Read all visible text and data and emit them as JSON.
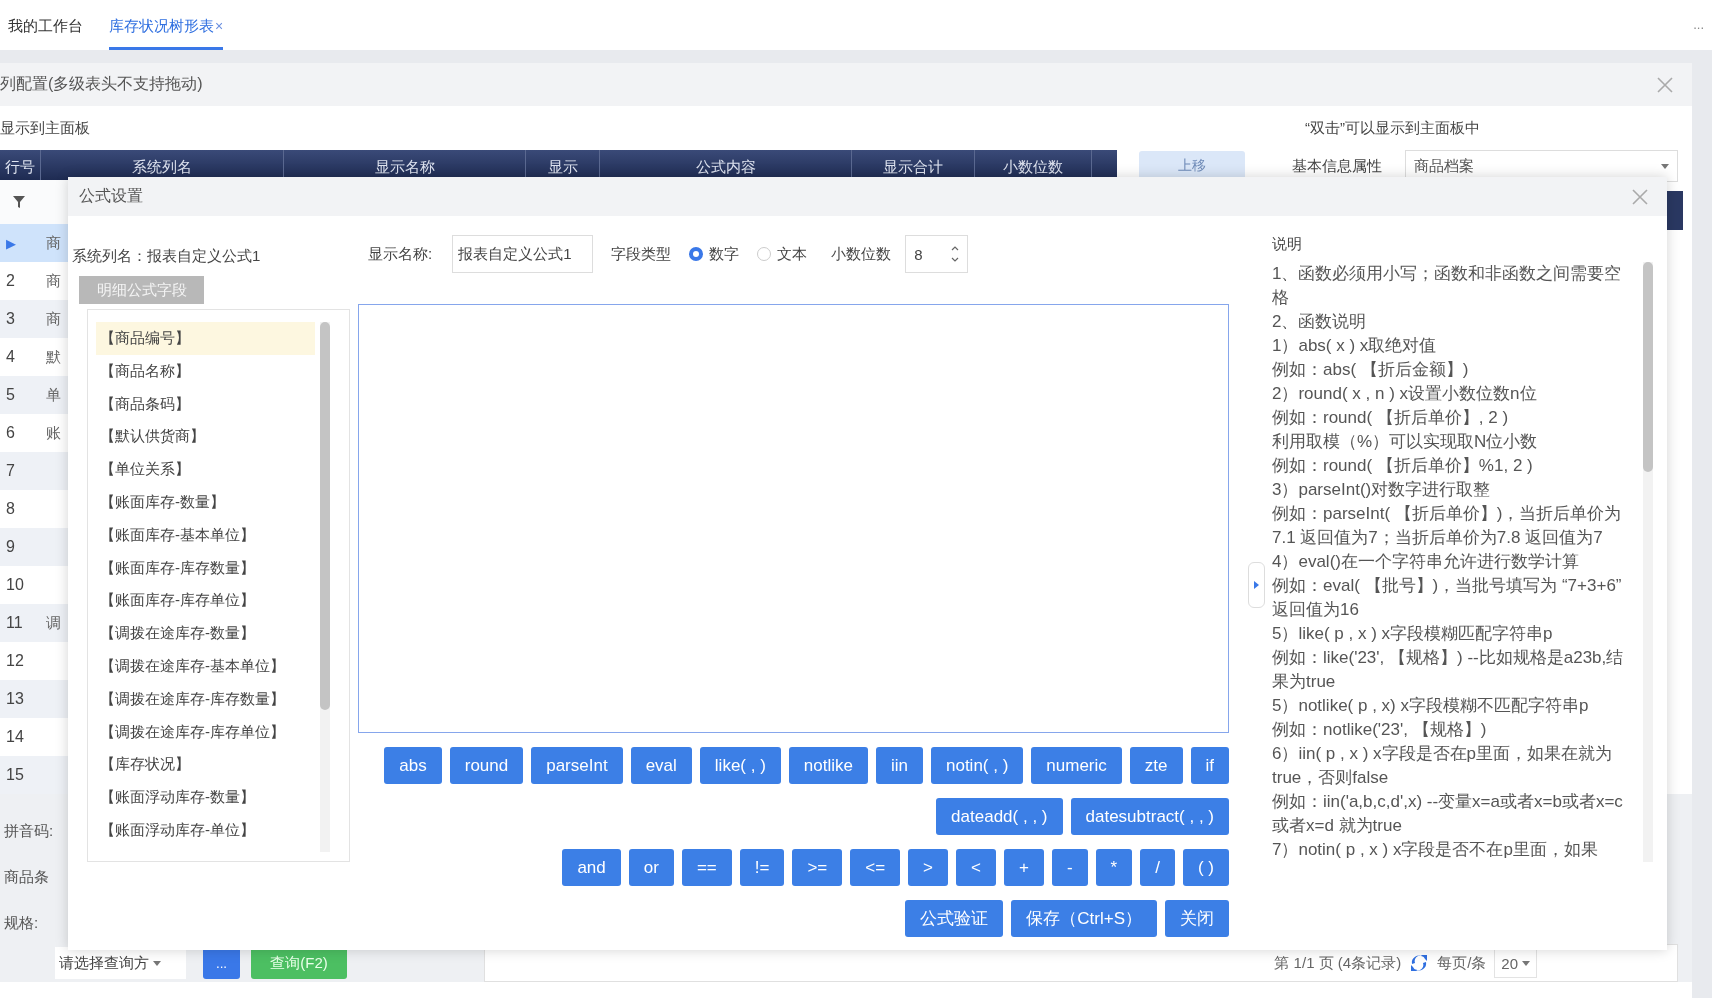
{
  "tabs": [
    {
      "label": "我的工作台",
      "selected": false
    },
    {
      "label": "库存状况树形表",
      "selected": true,
      "close": "×"
    }
  ],
  "more": "...",
  "column_config": {
    "title": "列配置(多级表头不支持拖动)",
    "hint_left": "显示到主面板",
    "hint_right": "“双击”可以显示到主面板中",
    "columns": [
      "行号",
      "系统列名",
      "显示名称",
      "显示",
      "公式内容",
      "显示合计",
      "小数位数"
    ],
    "rows": [
      {
        "number": "▶",
        "cell": "商",
        "selected": true
      },
      {
        "number": "2",
        "cell": "商",
        "selected": false
      },
      {
        "number": "3",
        "cell": "商",
        "selected": false
      },
      {
        "number": "4",
        "cell": "默",
        "selected": false
      },
      {
        "number": "5",
        "cell": "单",
        "selected": false
      },
      {
        "number": "6",
        "cell": "账",
        "selected": false
      },
      {
        "number": "7",
        "cell": "",
        "selected": false
      },
      {
        "number": "8",
        "cell": "",
        "selected": false
      },
      {
        "number": "9",
        "cell": "",
        "selected": false
      },
      {
        "number": "10",
        "cell": "",
        "selected": false
      },
      {
        "number": "11",
        "cell": "调",
        "selected": false
      },
      {
        "number": "12",
        "cell": "",
        "selected": false
      },
      {
        "number": "13",
        "cell": "",
        "selected": false
      },
      {
        "number": "14",
        "cell": "",
        "selected": false
      },
      {
        "number": "15",
        "cell": "",
        "selected": false
      }
    ],
    "move_up": {
      "label": "上移",
      "disabled": true
    },
    "attribute": {
      "label": "基本信息属性",
      "value": "商品档案"
    },
    "filters": [
      "拼音码:",
      "商品条",
      "规格:"
    ],
    "query_mode": "请选择查询方",
    "ellipsis_button": "...",
    "query_button": "查询(F2)",
    "pager": {
      "page": "第 1/1 页 (4条记录)",
      "per_page_label": "每页/条",
      "per_page": "20"
    }
  },
  "formula_dialog": {
    "title": "公式设置",
    "system_column": "系统列名：报表自定义公式1",
    "display_name_label": "显示名称:",
    "display_name": "报表自定义公式1",
    "field_type_label": "字段类型",
    "field_types": [
      {
        "label": "数字",
        "selected": true
      },
      {
        "label": "文本",
        "selected": false
      }
    ],
    "decimals_label": "小数位数",
    "decimals": "8",
    "fields_tab": "明细公式字段",
    "fields": [
      {
        "label": "【商品编号】",
        "selected": true
      },
      {
        "label": "【商品名称】",
        "selected": false
      },
      {
        "label": "【商品条码】",
        "selected": false
      },
      {
        "label": "【默认供货商】",
        "selected": false
      },
      {
        "label": "【单位关系】",
        "selected": false
      },
      {
        "label": "【账面库存-数量】",
        "selected": false
      },
      {
        "label": "【账面库存-基本单位】",
        "selected": false
      },
      {
        "label": "【账面库存-库存数量】",
        "selected": false
      },
      {
        "label": "【账面库存-库存单位】",
        "selected": false
      },
      {
        "label": "【调拨在途库存-数量】",
        "selected": false
      },
      {
        "label": "【调拨在途库存-基本单位】",
        "selected": false
      },
      {
        "label": "【调拨在途库存-库存数量】",
        "selected": false
      },
      {
        "label": "【调拨在途库存-库存单位】",
        "selected": false
      },
      {
        "label": "【库存状况】",
        "selected": false
      },
      {
        "label": "【账面浮动库存-数量】",
        "selected": false
      },
      {
        "label": "【账面浮动库存-单位】",
        "selected": false
      }
    ],
    "button_rows": [
      [
        "abs",
        "round",
        "parseInt",
        "eval",
        "like( , )",
        "notlike",
        "iin",
        "notin( , )",
        "numeric",
        "zte",
        "if"
      ],
      [
        "dateadd( , , )",
        "datesubtract( , , )"
      ],
      [
        "and",
        "or",
        "==",
        "!=",
        ">=",
        "<=",
        ">",
        "<",
        "+",
        "-",
        "*",
        "/",
        "( )"
      ],
      [
        "公式验证",
        "保存（Ctrl+S）",
        "关闭"
      ]
    ],
    "notes_title": "说明",
    "notes": [
      "1、函数必须用小写；函数和非函数之间需要空格",
      "2、函数说明",
      "1）abs( x ) x取绝对值",
      "例如：abs( 【折后金额】)",
      "2）round( x , n ) x设置小数位数n位",
      "例如：round( 【折后单价】, 2 )",
      "利用取模（%）可以实现取N位小数",
      "例如：round( 【折后单价】%1, 2 )",
      "3）parseInt()对数字进行取整",
      "例如：parseInt( 【折后单价】)，当折后单价为7.1 返回值为7；当折后单价为7.8 返回值为7",
      "4）eval()在一个字符串允许进行数学计算",
      "例如：eval( 【批号】)，当批号填写为 “7+3+6” 返回值为16",
      "5）like( p , x ) x字段模糊匹配字符串p",
      "例如：like('23', 【规格】) --比如规格是a23b,结果为true",
      "5）notlike( p , x) x字段模糊不匹配字符串p",
      "例如：notlike('23', 【规格】)",
      "6）iin( p , x ) x字段是否在p里面，如果在就为true，否则false",
      "例如：iin('a,b,c,d',x) --变量x=a或者x=b或者x=c或者x=d 就为true",
      "7）notin( p , x ) x字段是否不在p里面，如果"
    ]
  }
}
